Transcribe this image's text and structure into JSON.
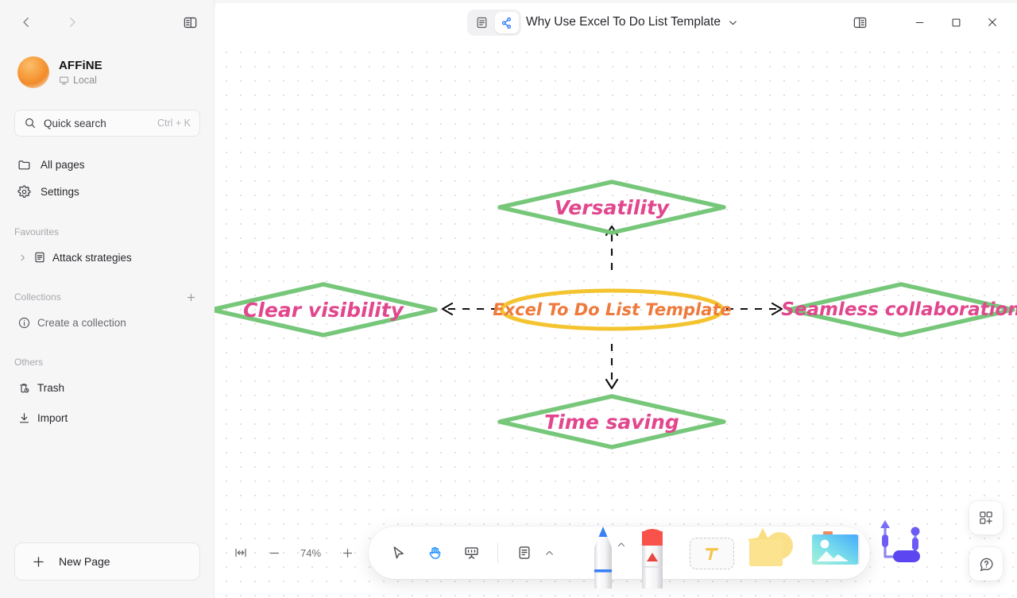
{
  "sidebar": {
    "nav_back": "back-arrow",
    "nav_forward": "forward-arrow",
    "toggle": "sidebar-toggle",
    "workspace": {
      "name": "AFFiNE",
      "sub": "Local",
      "sub_icon": "monitor-icon"
    },
    "search": {
      "label": "Quick search",
      "shortcut": "Ctrl + K",
      "icon": "search-icon"
    },
    "nav_items": [
      {
        "label": "All pages",
        "icon": "folder-icon"
      },
      {
        "label": "Settings",
        "icon": "gear-icon"
      }
    ],
    "sections": [
      {
        "title": "Favourites",
        "items": [
          {
            "label": "Attack strategies",
            "icon": "doc-icon"
          }
        ]
      },
      {
        "title": "Collections",
        "plus": "+",
        "items": [
          {
            "label": "Create a collection",
            "icon": "info-icon"
          }
        ]
      },
      {
        "title": "Others",
        "items": [
          {
            "label": "Trash",
            "icon": "trash-icon"
          },
          {
            "label": "Import",
            "icon": "download-icon"
          }
        ]
      }
    ],
    "new_page": {
      "label": "New Page",
      "icon": "plus-icon"
    }
  },
  "header": {
    "mode_page": "page-mode-icon",
    "mode_edgeless": "edgeless-mode-icon",
    "title": "Why Use Excel To Do List Template",
    "title_caret": "chevron-down-icon",
    "right_panel": "right-panel-icon",
    "minimize": "minimize-icon",
    "maximize": "maximize-icon",
    "close": "close-icon"
  },
  "canvas": {
    "center_node": {
      "label": "Excel To Do List Template",
      "shape": "ellipse",
      "stroke": "#f4c430",
      "text_color": "#ee7a3c"
    },
    "nodes": [
      {
        "id": "versatility",
        "label": "Versatility",
        "shape": "diamond",
        "stroke": "#77c77a",
        "text_color": "#e2478e"
      },
      {
        "id": "clear-visibility",
        "label": "Clear visibility",
        "shape": "diamond",
        "stroke": "#77c77a",
        "text_color": "#e2478e"
      },
      {
        "id": "seamless-collaboration",
        "label": "Seamless collaboration",
        "shape": "diamond",
        "stroke": "#77c77a",
        "text_color": "#e2478e"
      },
      {
        "id": "time-saving",
        "label": "Time saving",
        "shape": "diamond",
        "stroke": "#77c77a",
        "text_color": "#e2478e"
      }
    ],
    "connector_style": "dashed-arrow",
    "connector_color": "#111111"
  },
  "toolbar": {
    "left_tools": [
      {
        "name": "select-tool",
        "icon": "cursor-arrow-icon",
        "active": false
      },
      {
        "name": "hand-tool",
        "icon": "hand-icon",
        "active": true
      },
      {
        "name": "present-tool",
        "icon": "presentation-icon",
        "active": false
      }
    ],
    "note_tool": {
      "icon": "note-icon",
      "caret": "chevron-up-icon"
    },
    "creative_tools": [
      {
        "name": "pen-tool",
        "icon": "pen-icon"
      },
      {
        "name": "eraser-tool",
        "icon": "eraser-icon"
      },
      {
        "name": "text-tool",
        "icon": "text-t-icon"
      },
      {
        "name": "shape-tool",
        "icon": "shapes-icon"
      },
      {
        "name": "image-tool",
        "icon": "image-icon"
      },
      {
        "name": "connector-tool",
        "icon": "connector-icon"
      }
    ],
    "pen_caret": "chevron-up-icon"
  },
  "zoom": {
    "fit_icon": "fit-to-screen-icon",
    "minus": "minus-icon",
    "percent": "74%",
    "plus": "plus-icon"
  },
  "float_buttons": [
    {
      "name": "add-template-button",
      "icon": "template-add-icon"
    },
    {
      "name": "help-button",
      "icon": "question-bubble-icon"
    }
  ]
}
